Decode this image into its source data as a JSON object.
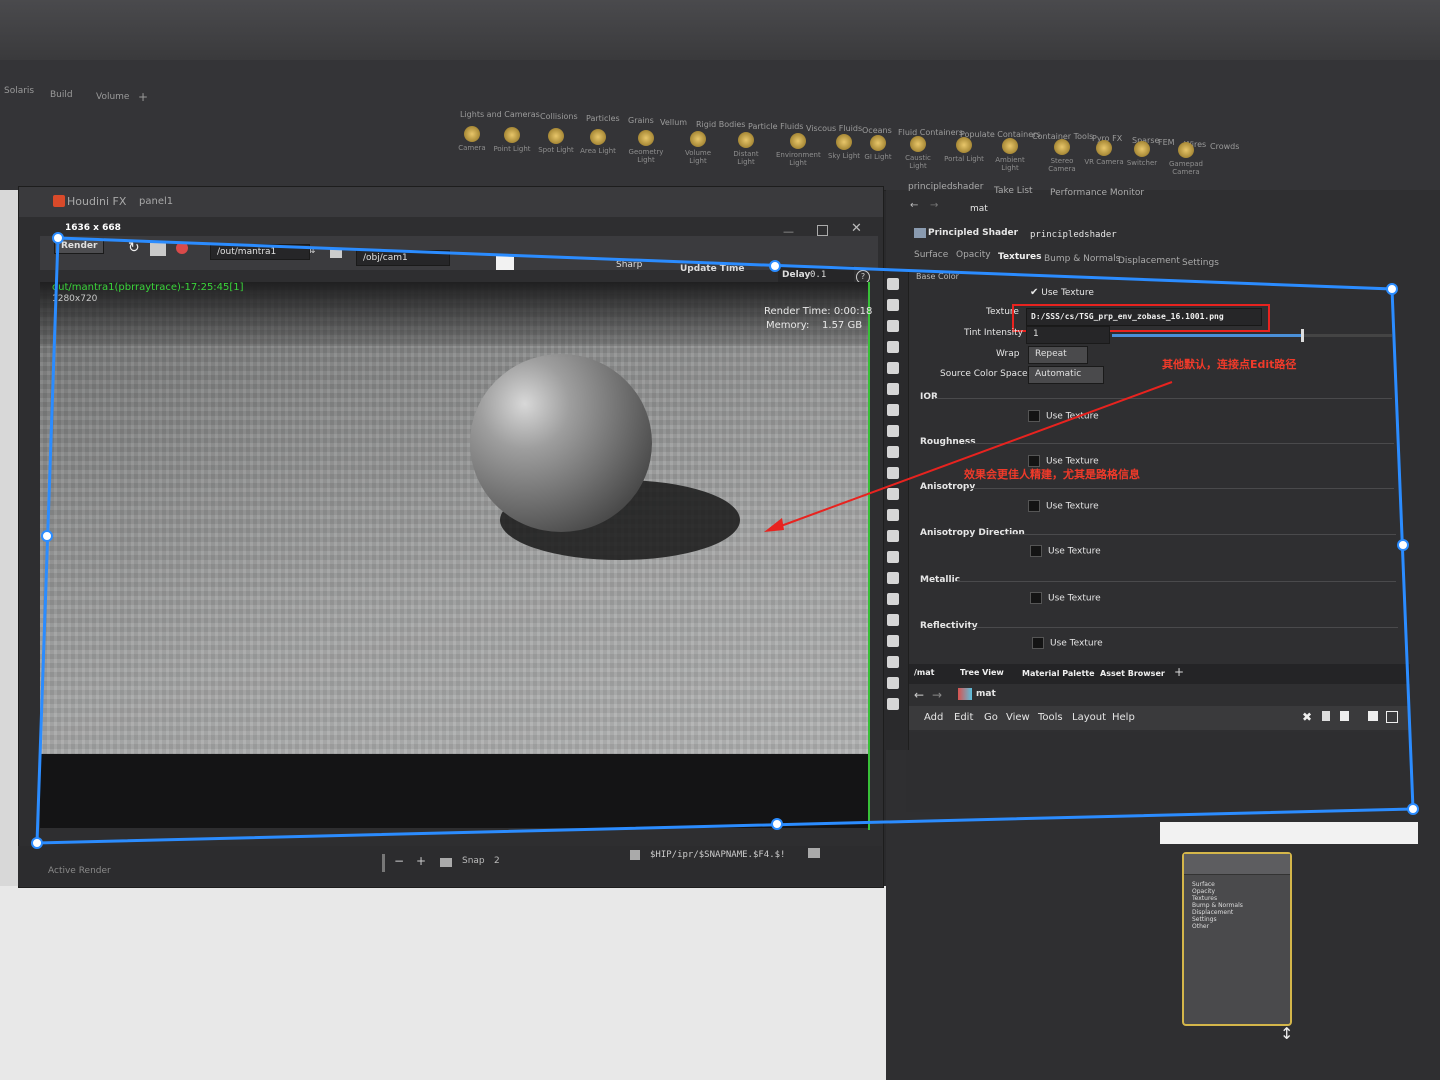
{
  "desktops": {
    "tabs": [
      "Solaris",
      "Build",
      "Volume"
    ],
    "plus": "+"
  },
  "shelf": {
    "tabs": [
      "Lights and Cameras",
      "Collisions",
      "Particles",
      "Grains",
      "Vellum",
      "Rigid Bodies",
      "Particle Fluids",
      "Viscous Fluids",
      "Oceans",
      "Fluid Containers",
      "Populate Containers",
      "Container Tools",
      "Pyro FX",
      "Sparse",
      "FEM",
      "Wires",
      "Crowds"
    ],
    "tools": [
      "Camera",
      "Point Light",
      "Spot Light",
      "Area Light",
      "Geometry Light",
      "Volume Light",
      "Distant Light",
      "Environment Light",
      "Sky Light",
      "GI Light",
      "Caustic Light",
      "Portal Light",
      "Ambient Light",
      "Stereo Camera",
      "VR Camera",
      "Switcher",
      "Gamepad Camera"
    ]
  },
  "float_window": {
    "title": "Houdini FX",
    "panel": "panel1",
    "resolution": "1636  x  668"
  },
  "viewer_toolbar": {
    "render_label": "Render",
    "output_path": "/out/mantra1",
    "camera_path": "/obj/cam1",
    "preview_label": "Sharp",
    "update_label": "Update Time",
    "delay_label": "Delay",
    "delay_value": "0.1",
    "help": "?"
  },
  "render_view": {
    "image_label": "out/mantra1(pbrraytrace)-17:25:45[1]",
    "image_size": "1280x720",
    "render_time_label": "Render Time:",
    "render_time_value": "0:00:18",
    "memory_label": "Memory:",
    "memory_value": "1.57 GB"
  },
  "bottom_bar": {
    "active_render": "Active Render",
    "snap": "Snap",
    "snap_value": "2",
    "snapshot_path": "$HIP/ipr/$SNAPNAME.$F4.$!"
  },
  "right_tabs": {
    "tabs": [
      "principledshader",
      "Take List",
      "Performance Monitor"
    ],
    "path": "mat"
  },
  "shader": {
    "type_label": "Principled Shader",
    "name": "principledshader",
    "tabs": [
      "Surface",
      "Opacity",
      "Textures",
      "Bump & Normals",
      "Displacement",
      "Settings"
    ],
    "active_tab": "Textures",
    "section_base": "Base Color",
    "use_texture_label": "Use Texture",
    "texture_label": "Texture",
    "texture_value": "D:/SSS/cs/TSG_prp_env_zobase_16.1001.png",
    "tint_label": "Tint Intensity",
    "tint_value": "1",
    "tint_fraction": 0.68,
    "wrap_label": "Wrap",
    "wrap_value": "Repeat",
    "colorspace_label": "Source Color Space",
    "colorspace_value": "Automatic",
    "sections": [
      "IOR",
      "Roughness",
      "Anisotropy",
      "Anisotropy Direction",
      "Metallic",
      "Reflectivity"
    ]
  },
  "annotations": {
    "note_top": "其他默认，连接点Edit路径",
    "note_bottom": "效果会更佳人精建，尤其是路格信息"
  },
  "network": {
    "tabs": [
      "/mat",
      "Tree View",
      "Material Palette",
      "Asset Browser"
    ],
    "path": "mat",
    "menu": [
      "Add",
      "Edit",
      "Go",
      "View",
      "Tools",
      "Layout",
      "Help"
    ]
  },
  "node": {
    "items": [
      "Surface",
      "Opacity",
      "Textures",
      "Bump & Normals",
      "Displacement",
      "Settings",
      "Other"
    ]
  },
  "colors": {
    "selection": "#2b8cff",
    "annotation": "#e8231f",
    "render_green": "#38c038"
  }
}
